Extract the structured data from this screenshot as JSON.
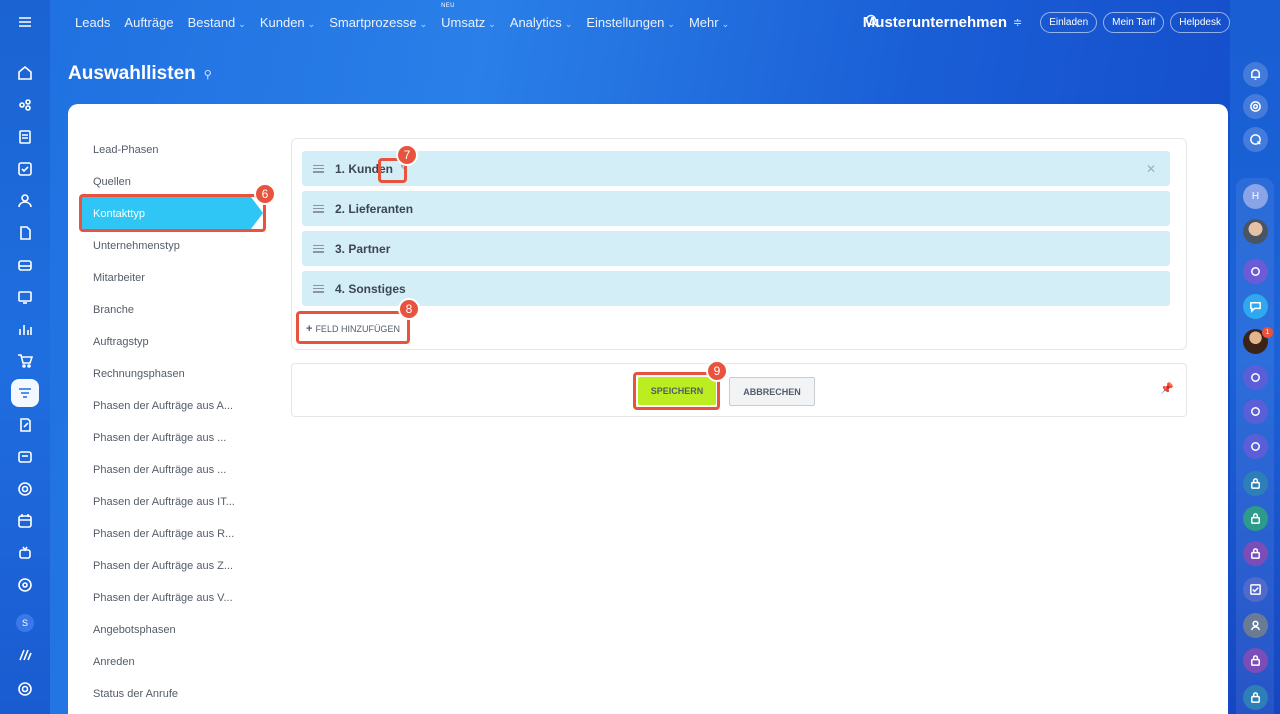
{
  "topbar": {
    "nav": [
      {
        "label": "Leads",
        "chevron": false
      },
      {
        "label": "Aufträge",
        "chevron": false
      },
      {
        "label": "Bestand",
        "chevron": true
      },
      {
        "label": "Kunden",
        "chevron": true
      },
      {
        "label": "Smartprozesse",
        "chevron": true
      },
      {
        "label": "Umsatz",
        "chevron": true,
        "badge": "NEU"
      },
      {
        "label": "Analytics",
        "chevron": true
      },
      {
        "label": "Einstellungen",
        "chevron": true
      },
      {
        "label": "Mehr",
        "chevron": true
      }
    ],
    "company": "Musterunternehmen",
    "invite": "Einladen",
    "plan": "Mein Tarif",
    "helpdesk": "Helpdesk"
  },
  "page": {
    "title": "Auswahllisten"
  },
  "menu": {
    "items": [
      "Lead-Phasen",
      "Quellen",
      "Kontakttyp",
      "Unternehmenstyp",
      "Mitarbeiter",
      "Branche",
      "Auftragstyp",
      "Rechnungsphasen",
      "Phasen der Aufträge aus A...",
      "Phasen der Aufträge aus ...",
      "Phasen der Aufträge aus ...",
      "Phasen der Aufträge aus IT...",
      "Phasen der Aufträge aus R...",
      "Phasen der Aufträge aus Z...",
      "Phasen der Aufträge aus V...",
      "Angebotsphasen",
      "Anreden",
      "Status der Anrufe"
    ],
    "active_index": 2
  },
  "entries": {
    "rows": [
      "1. Kunden",
      "2. Lieferanten",
      "3. Partner",
      "4. Sonstiges"
    ],
    "add_label": "FELD HINZUFÜGEN"
  },
  "actions": {
    "save": "SPEICHERN",
    "cancel": "ABBRECHEN"
  },
  "annotations": {
    "menu": "6",
    "edit": "7",
    "add": "8",
    "save": "9"
  },
  "rightbar": {
    "notification_count": "1",
    "avatar_initial": "H"
  },
  "leftbar": {
    "user_initial": "S"
  },
  "colors": {
    "accent": "#2fc6f6",
    "save": "#bbed21",
    "highlight": "#e8533d",
    "row": "#d4eef8"
  }
}
